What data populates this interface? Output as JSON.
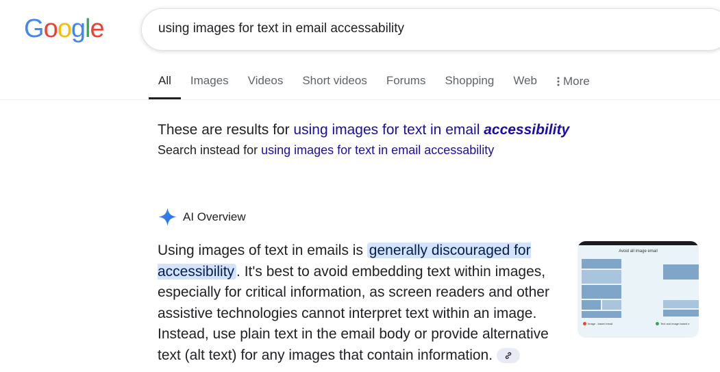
{
  "logo": {
    "text": "Google"
  },
  "search": {
    "query": "using images for text in email accessability"
  },
  "tabs": [
    {
      "label": "All"
    },
    {
      "label": "Images"
    },
    {
      "label": "Videos"
    },
    {
      "label": "Short videos"
    },
    {
      "label": "Forums"
    },
    {
      "label": "Shopping"
    },
    {
      "label": "Web"
    },
    {
      "label": "More"
    }
  ],
  "spelling": {
    "prefix": "These are results for ",
    "corrected_plain": "using images for text in email ",
    "corrected_bold": "accessibility",
    "instead_prefix": "Search instead for ",
    "original_query": "using images for text in email accessability"
  },
  "ai_overview": {
    "title": "AI Overview",
    "text_before": "Using images of text in emails is ",
    "highlight": "generally discouraged for accessibility",
    "text_after": ". It's best to avoid embedding text within im­ages, especially for critical information, as screen readers and other assistive technologies cannot interpret text within an image. Instead, use plain text in the email body or pro­vide alternative text (alt text) for any images that contain information.",
    "thumbnail": {
      "title": "Avoid all image email",
      "caption_left": "Image - based email",
      "caption_right": "Text and image based e"
    }
  },
  "colors": {
    "link": "#1a0dab",
    "highlight": "#d3e3fd",
    "blue": "#4285F4",
    "red": "#EA4335",
    "yellow": "#FBBC05",
    "green": "#34A853"
  },
  "icons": [
    "dots-vertical-icon",
    "ai-sparkle-icon",
    "link-icon"
  ]
}
